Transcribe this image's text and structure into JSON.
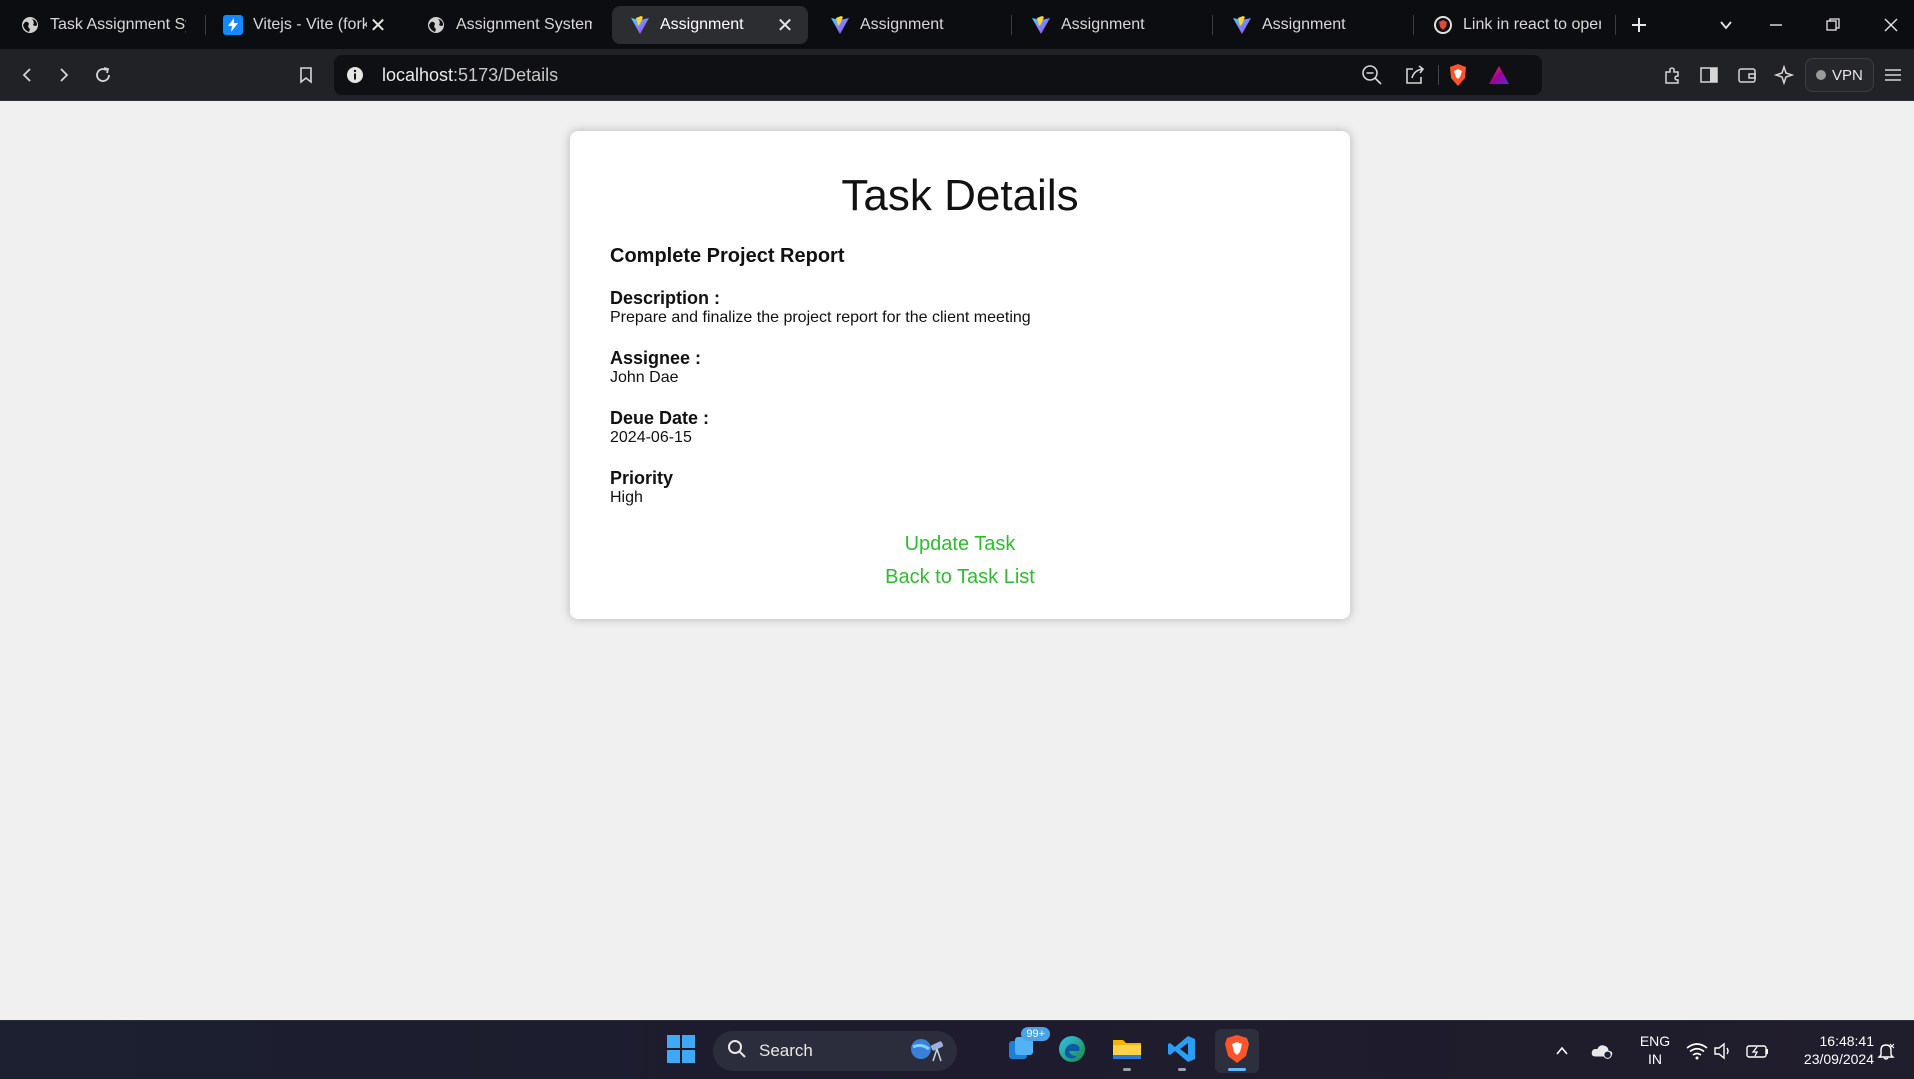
{
  "tabs": [
    {
      "label": "Task Assignment Syst",
      "icon": "globe-icon"
    },
    {
      "label": "Vitejs - Vite (fork",
      "icon": "stackblitz-icon"
    },
    {
      "label": "Assignment System",
      "icon": "globe-icon"
    },
    {
      "label": "Assignment",
      "icon": "vite-icon"
    },
    {
      "label": "Assignment",
      "icon": "vite-icon"
    },
    {
      "label": "Assignment",
      "icon": "vite-icon"
    },
    {
      "label": "Assignment",
      "icon": "vite-icon"
    },
    {
      "label": "Link in react to open",
      "icon": "brave-shield-icon"
    }
  ],
  "address": {
    "host": "localhost",
    "path": ":5173/Details"
  },
  "vpn_label": "VPN",
  "page": {
    "heading": "Task Details",
    "task_title": "Complete Project Report",
    "fields": [
      {
        "label": "Description :",
        "value": "Prepare and finalize the project report for the client meeting"
      },
      {
        "label": "Assignee :",
        "value": "John Dae"
      },
      {
        "label": "Deue Date :",
        "value": "2024-06-15"
      },
      {
        "label": "Priority",
        "value": "High"
      }
    ],
    "update_link": "Update Task",
    "back_link": "Back to Task List"
  },
  "taskbar": {
    "search_label": "Search",
    "notification_badge": "99+",
    "lang_line1": "ENG",
    "lang_line2": "IN",
    "time": "16:48:41",
    "date": "23/09/2024"
  },
  "colors": {
    "link": "#2ebd2e",
    "page_bg": "#f0f0f0",
    "card_bg": "#ffffff"
  }
}
